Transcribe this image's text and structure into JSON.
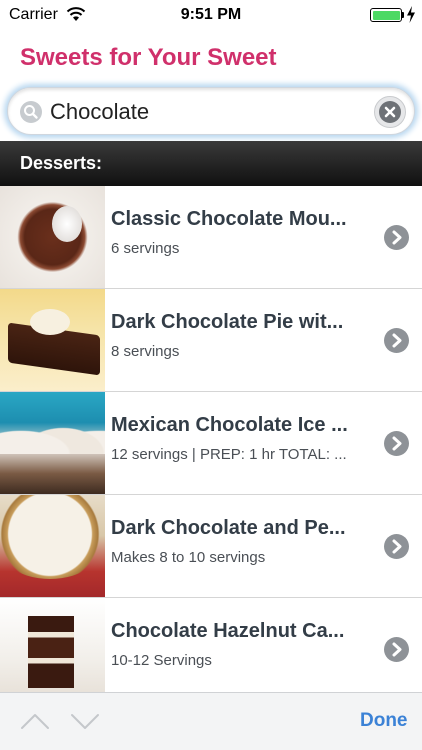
{
  "status_bar": {
    "carrier": "Carrier",
    "time": "9:51 PM",
    "icons": [
      "wifi-icon",
      "battery-icon",
      "charging-icon"
    ],
    "battery_color": "#4cd964"
  },
  "app": {
    "title": "Sweets for Your Sweet",
    "title_color": "#d0306b"
  },
  "search": {
    "value": "Chocolate",
    "placeholder": ""
  },
  "section": {
    "label": "Desserts:"
  },
  "recipes": [
    {
      "title": "Classic Chocolate Mou...",
      "subtitle": "6 servings"
    },
    {
      "title": "Dark Chocolate Pie wit...",
      "subtitle": "8 servings"
    },
    {
      "title": "Mexican Chocolate Ice ...",
      "subtitle": "12 servings | PREP: 1 hr TOTAL: ..."
    },
    {
      "title": "Dark Chocolate and Pe...",
      "subtitle": "Makes 8 to 10 servings"
    },
    {
      "title": "Chocolate Hazelnut Ca...",
      "subtitle": "10-12 Servings"
    }
  ],
  "toolbar": {
    "done_label": "Done",
    "accent_color": "#3b82d6",
    "icons": [
      "chevron-up-icon",
      "chevron-down-icon"
    ]
  }
}
